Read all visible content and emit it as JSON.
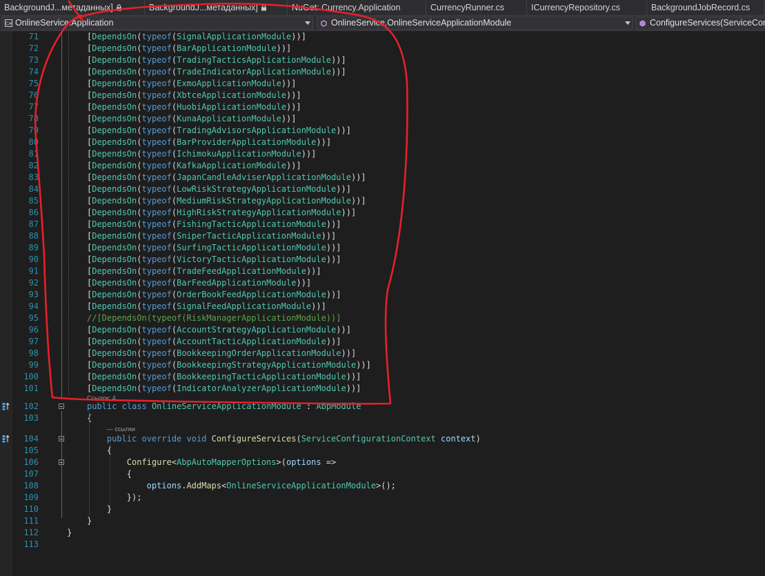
{
  "tabs": [
    {
      "label": "BackgroundJ...метаданных]",
      "locked": true
    },
    {
      "label": "BackgroundJ...метаданных]",
      "locked": true
    },
    {
      "label": "NuGet: Currency.Application",
      "locked": false
    },
    {
      "label": "CurrencyRunner.cs",
      "locked": false
    },
    {
      "label": "ICurrencyRepository.cs",
      "locked": false
    },
    {
      "label": "BackgroundJobRecord.cs",
      "locked": false
    }
  ],
  "navbar": {
    "project": "OnlineService.Application",
    "type": "OnlineService.OnlineServiceApplicationModule",
    "member": "ConfigureServices(ServiceConfi"
  },
  "colors": {
    "keyword": "#569cd6",
    "type": "#4ec9b0",
    "method": "#dcdcaa",
    "variable": "#9cdcfe",
    "comment": "#57a64a",
    "line_number": "#2b91af",
    "annotation": "#e8202a"
  },
  "depends_on_modules": [
    {
      "line": "71",
      "module": "SignalApplicationModule"
    },
    {
      "line": "72",
      "module": "BarApplicationModule"
    },
    {
      "line": "73",
      "module": "TradingTacticsApplicationModule"
    },
    {
      "line": "74",
      "module": "TradeIndicatorApplicationModule"
    },
    {
      "line": "75",
      "module": "ExmoApplicationModule"
    },
    {
      "line": "76",
      "module": "XbtceApplicationModule"
    },
    {
      "line": "77",
      "module": "HuobiApplicationModule"
    },
    {
      "line": "78",
      "module": "KunaApplicationModule"
    },
    {
      "line": "79",
      "module": "TradingAdvisorsApplicationModule"
    },
    {
      "line": "80",
      "module": "BarProviderApplicationModule"
    },
    {
      "line": "81",
      "module": "IchimokuApplicationModule"
    },
    {
      "line": "82",
      "module": "KafkaApplicationModule"
    },
    {
      "line": "83",
      "module": "JapanCandleAdviserApplicationModule"
    },
    {
      "line": "84",
      "module": "LowRiskStrategyApplicationModule"
    },
    {
      "line": "85",
      "module": "MediumRiskStrategyApplicationModule"
    },
    {
      "line": "86",
      "module": "HighRiskStrategyApplicationModule"
    },
    {
      "line": "87",
      "module": "FishingTacticApplicationModule"
    },
    {
      "line": "88",
      "module": "SniperTacticApplicationModule"
    },
    {
      "line": "89",
      "module": "SurfingTacticApplicationModule"
    },
    {
      "line": "90",
      "module": "VictoryTacticApplicationModule"
    },
    {
      "line": "91",
      "module": "TradeFeedApplicationModule"
    },
    {
      "line": "92",
      "module": "BarFeedApplicationModule"
    },
    {
      "line": "93",
      "module": "OrderBookFeedApplicationModule"
    },
    {
      "line": "94",
      "module": "SignalFeedApplicationModule"
    },
    {
      "line": "95",
      "module": "RiskManagerApplicationModule",
      "commented": true
    },
    {
      "line": "96",
      "module": "AccountStrategyApplicationModule"
    },
    {
      "line": "97",
      "module": "AccountTacticApplicationModule"
    },
    {
      "line": "98",
      "module": "BookkeepingOrderApplicationModule"
    },
    {
      "line": "99",
      "module": "BookkeepingStrategyApplicationModule"
    },
    {
      "line": "100",
      "module": "BookkeepingTacticApplicationModule"
    },
    {
      "line": "101",
      "module": "IndicatorAnalyzerApplicationModule"
    }
  ],
  "codelens": {
    "class_refs": "Ссылок: 4",
    "method_refs": "— ссылки"
  },
  "class_lines": [
    {
      "line": "102",
      "tokens": [
        [
          "kw",
          "public"
        ],
        [
          "t",
          " "
        ],
        [
          "kw",
          "class"
        ],
        [
          "t",
          " "
        ],
        [
          "ty",
          "OnlineServiceApplicationModule"
        ],
        [
          "t",
          " : "
        ],
        [
          "ty",
          "AbpModule"
        ]
      ]
    },
    {
      "line": "103",
      "tokens": [
        [
          "t",
          "{"
        ]
      ]
    },
    {
      "line": "104",
      "tokens": [
        [
          "kw",
          "public"
        ],
        [
          "t",
          " "
        ],
        [
          "kw",
          "override"
        ],
        [
          "t",
          " "
        ],
        [
          "kw",
          "void"
        ],
        [
          "t",
          " "
        ],
        [
          "mt",
          "ConfigureServices"
        ],
        [
          "t",
          "("
        ],
        [
          "ty",
          "ServiceConfigurationContext"
        ],
        [
          "t",
          " "
        ],
        [
          "vr",
          "context"
        ],
        [
          "t",
          ")"
        ]
      ]
    },
    {
      "line": "105",
      "tokens": [
        [
          "t",
          "{"
        ]
      ]
    },
    {
      "line": "106",
      "tokens": [
        [
          "mt",
          "Configure"
        ],
        [
          "t",
          "<"
        ],
        [
          "ty",
          "AbpAutoMapperOptions"
        ],
        [
          "t",
          ">("
        ],
        [
          "vr",
          "options"
        ],
        [
          "t",
          " =>"
        ]
      ]
    },
    {
      "line": "107",
      "tokens": [
        [
          "t",
          "{"
        ]
      ]
    },
    {
      "line": "108",
      "tokens": [
        [
          "vr",
          "options"
        ],
        [
          "t",
          "."
        ],
        [
          "mt",
          "AddMaps"
        ],
        [
          "t",
          "<"
        ],
        [
          "ty",
          "OnlineServiceApplicationModule"
        ],
        [
          "t",
          ">();"
        ]
      ]
    },
    {
      "line": "109",
      "tokens": [
        [
          "t",
          "});"
        ]
      ]
    },
    {
      "line": "110",
      "tokens": [
        [
          "t",
          "}"
        ]
      ]
    },
    {
      "line": "111",
      "tokens": [
        [
          "t",
          "}"
        ]
      ]
    },
    {
      "line": "112",
      "tokens": [
        [
          "t",
          "}"
        ]
      ]
    },
    {
      "line": "113",
      "tokens": []
    }
  ]
}
